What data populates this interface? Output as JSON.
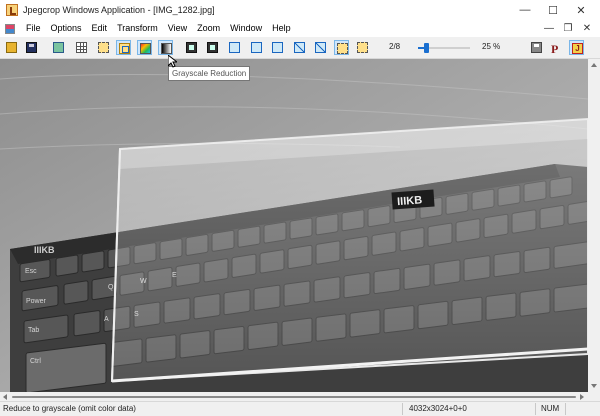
{
  "window": {
    "title": "Jpegcrop Windows Application - [IMG_1282.jpg]",
    "controls": {
      "minimize": "—",
      "maximize": "☐",
      "close": "✕"
    }
  },
  "menubar": {
    "items": [
      "File",
      "Options",
      "Edit",
      "Transform",
      "View",
      "Zoom",
      "Window",
      "Help"
    ],
    "mdi_controls": {
      "minimize": "—",
      "restore": "❐",
      "close": "✕"
    }
  },
  "toolbar": {
    "page_indicator": "2/8",
    "zoom_percent": "25 %",
    "zoom_level": 0.12
  },
  "tooltip": {
    "text": "Grayscale Reduction"
  },
  "image": {
    "logo_text": "IIIKB",
    "small_logo_text": "IIIKB",
    "key_labels": [
      "Esc",
      "Power",
      "Tab",
      "Ctrl",
      "Q",
      "W",
      "E",
      "A",
      "S"
    ]
  },
  "statusbar": {
    "message": "Reduce to grayscale (omit color data)",
    "dimensions": "4032x3024+0+0",
    "num": "NUM"
  },
  "colors": {
    "accent": "#1a6fd0",
    "pressed_button_bg": "#cfe6fb"
  }
}
